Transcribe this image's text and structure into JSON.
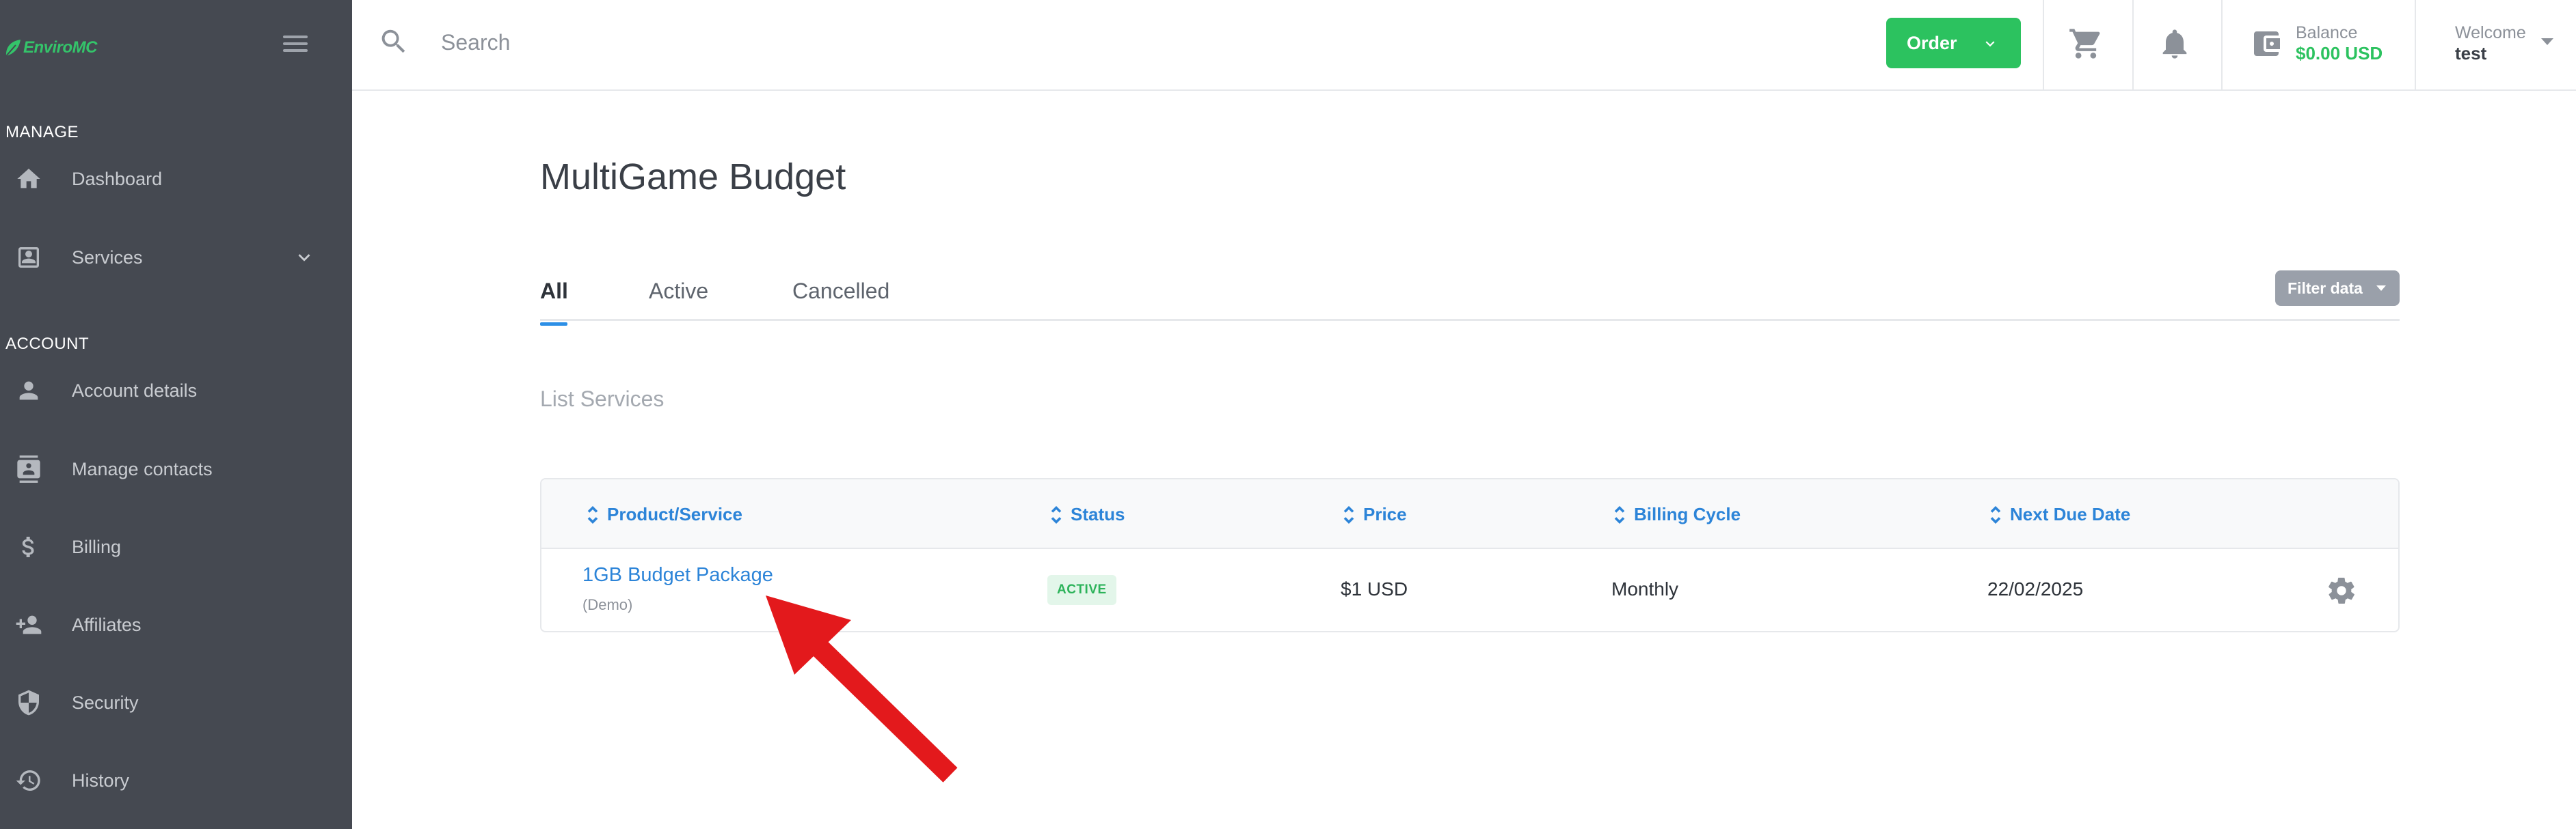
{
  "brand": {
    "name": "EnviroMC",
    "color": "#34c46a"
  },
  "sidebar": {
    "sections": [
      {
        "title": "MANAGE"
      },
      {
        "title": "ACCOUNT"
      }
    ],
    "items": [
      {
        "label": "Dashboard",
        "icon": "home-icon"
      },
      {
        "label": "Services",
        "icon": "services-icon",
        "expandable": true
      },
      {
        "label": "Account details",
        "icon": "person-icon"
      },
      {
        "label": "Manage contacts",
        "icon": "contacts-icon"
      },
      {
        "label": "Billing",
        "icon": "dollar-icon"
      },
      {
        "label": "Affiliates",
        "icon": "add-user-icon"
      },
      {
        "label": "Security",
        "icon": "shield-icon"
      },
      {
        "label": "History",
        "icon": "history-icon"
      }
    ]
  },
  "topbar": {
    "search": {
      "placeholder": "Search",
      "value": ""
    },
    "order_label": "Order",
    "balance": {
      "label": "Balance",
      "value": "$0.00 USD"
    },
    "user": {
      "welcome": "Welcome",
      "name": "test"
    }
  },
  "main": {
    "title": "MultiGame Budget",
    "tabs": [
      {
        "label": "All",
        "active": true
      },
      {
        "label": "Active",
        "active": false
      },
      {
        "label": "Cancelled",
        "active": false
      }
    ],
    "filter_label": "Filter data",
    "list_title": "List Services",
    "table": {
      "headers": [
        "Product/Service",
        "Status",
        "Price",
        "Billing Cycle",
        "Next Due Date"
      ],
      "rows": [
        {
          "product": "1GB Budget Package",
          "product_sub": "(Demo)",
          "status": "ACTIVE",
          "price": "$1 USD",
          "billing_cycle": "Monthly",
          "next_due": "22/02/2025"
        }
      ]
    }
  },
  "colors": {
    "sidebar_bg": "#454951",
    "accent_green": "#2cc25f",
    "link_blue": "#2c84d8",
    "annotation_arrow": "#e3191c"
  }
}
